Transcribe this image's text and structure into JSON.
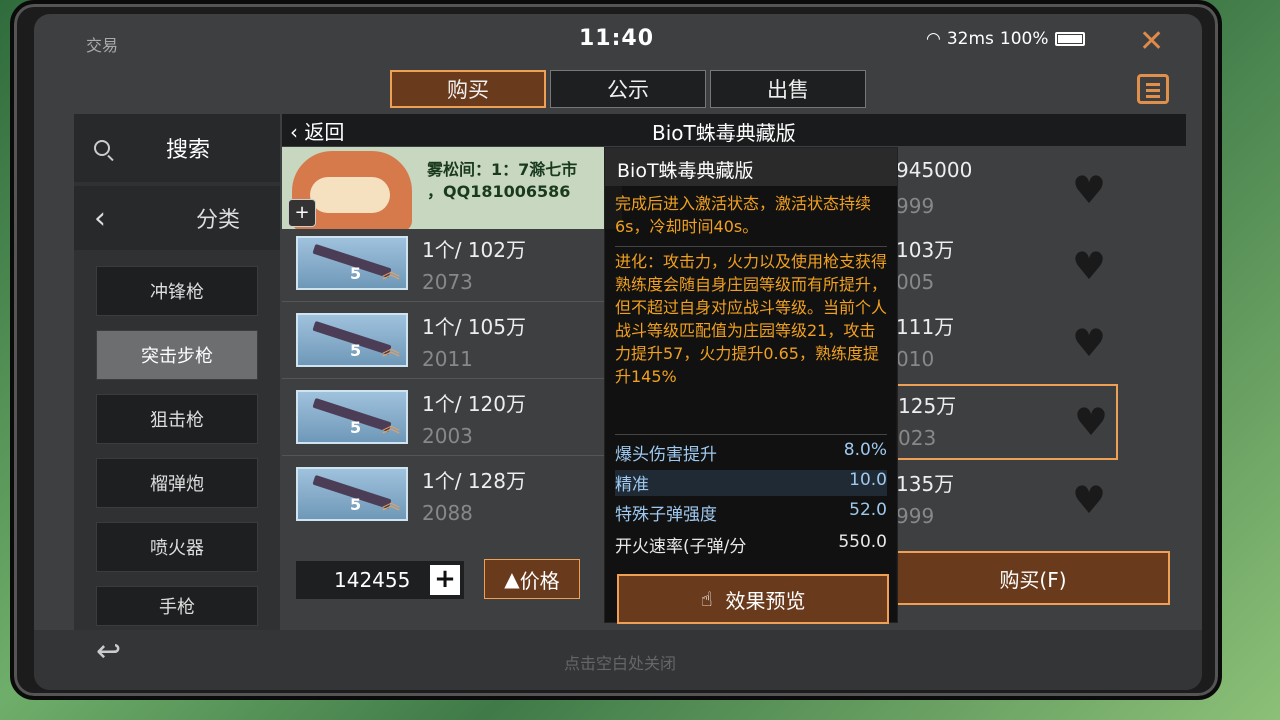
{
  "status": {
    "app_title": "交易",
    "clock": "11:40",
    "signal": "32ms",
    "battery": "100%"
  },
  "tabs": [
    {
      "label": "购买"
    },
    {
      "label": "公示"
    },
    {
      "label": "出售"
    }
  ],
  "sidebar": {
    "search_label": "搜索",
    "category_label": "分类",
    "categories": [
      {
        "label": "冲锋枪"
      },
      {
        "label": "突击步枪"
      },
      {
        "label": "狙击枪"
      },
      {
        "label": "榴弹炮"
      },
      {
        "label": "喷火器"
      },
      {
        "label": "手枪"
      }
    ]
  },
  "header": {
    "back_label": "返回",
    "title": "BioT蛛毒典藏版"
  },
  "banner": {
    "line1": "雾松间：1：7滁七市",
    "line2": "，QQ181006586"
  },
  "listings_left": [
    {
      "price": "1个/ 102万",
      "count": "2073",
      "level": "5"
    },
    {
      "price": "1个/ 105万",
      "count": "2011",
      "level": "5"
    },
    {
      "price": "1个/ 120万",
      "count": "2003",
      "level": "5"
    },
    {
      "price": "1个/ 128万",
      "count": "2088",
      "level": "5"
    }
  ],
  "listings_right": [
    {
      "price": " 945000",
      "count": "999"
    },
    {
      "price": " 103万",
      "count": "005"
    },
    {
      "price": " 111万",
      "count": "010"
    },
    {
      "price": " 125万",
      "count": "023"
    },
    {
      "price": " 135万",
      "count": "999"
    }
  ],
  "gold": {
    "amount": "142455"
  },
  "sort": {
    "label": "价格"
  },
  "buy": {
    "label": "购买(F)"
  },
  "footer": {
    "hint": "点击空白处关闭"
  },
  "tooltip": {
    "title": "BioT蛛毒典藏版",
    "para1": "完成后进入激活状态，激活状态持续6s，冷却时间40s。",
    "para2": "进化：攻击力，火力以及使用枪支获得熟练度会随自身庄园等级而有所提升，但不超过自身对应战斗等级。当前个人战斗等级匹配值为庄园等级21，攻击力提升57，火力提升0.65，熟练度提升145%",
    "stats": [
      {
        "name": "爆头伤害提升",
        "value": "8.0%"
      },
      {
        "name": "精准",
        "value": "10.0"
      },
      {
        "name": "特殊子弹强度",
        "value": "52.0"
      },
      {
        "name": "开火速率(子弹/分",
        "value": "550.0"
      }
    ],
    "preview_label": "效果预览"
  }
}
